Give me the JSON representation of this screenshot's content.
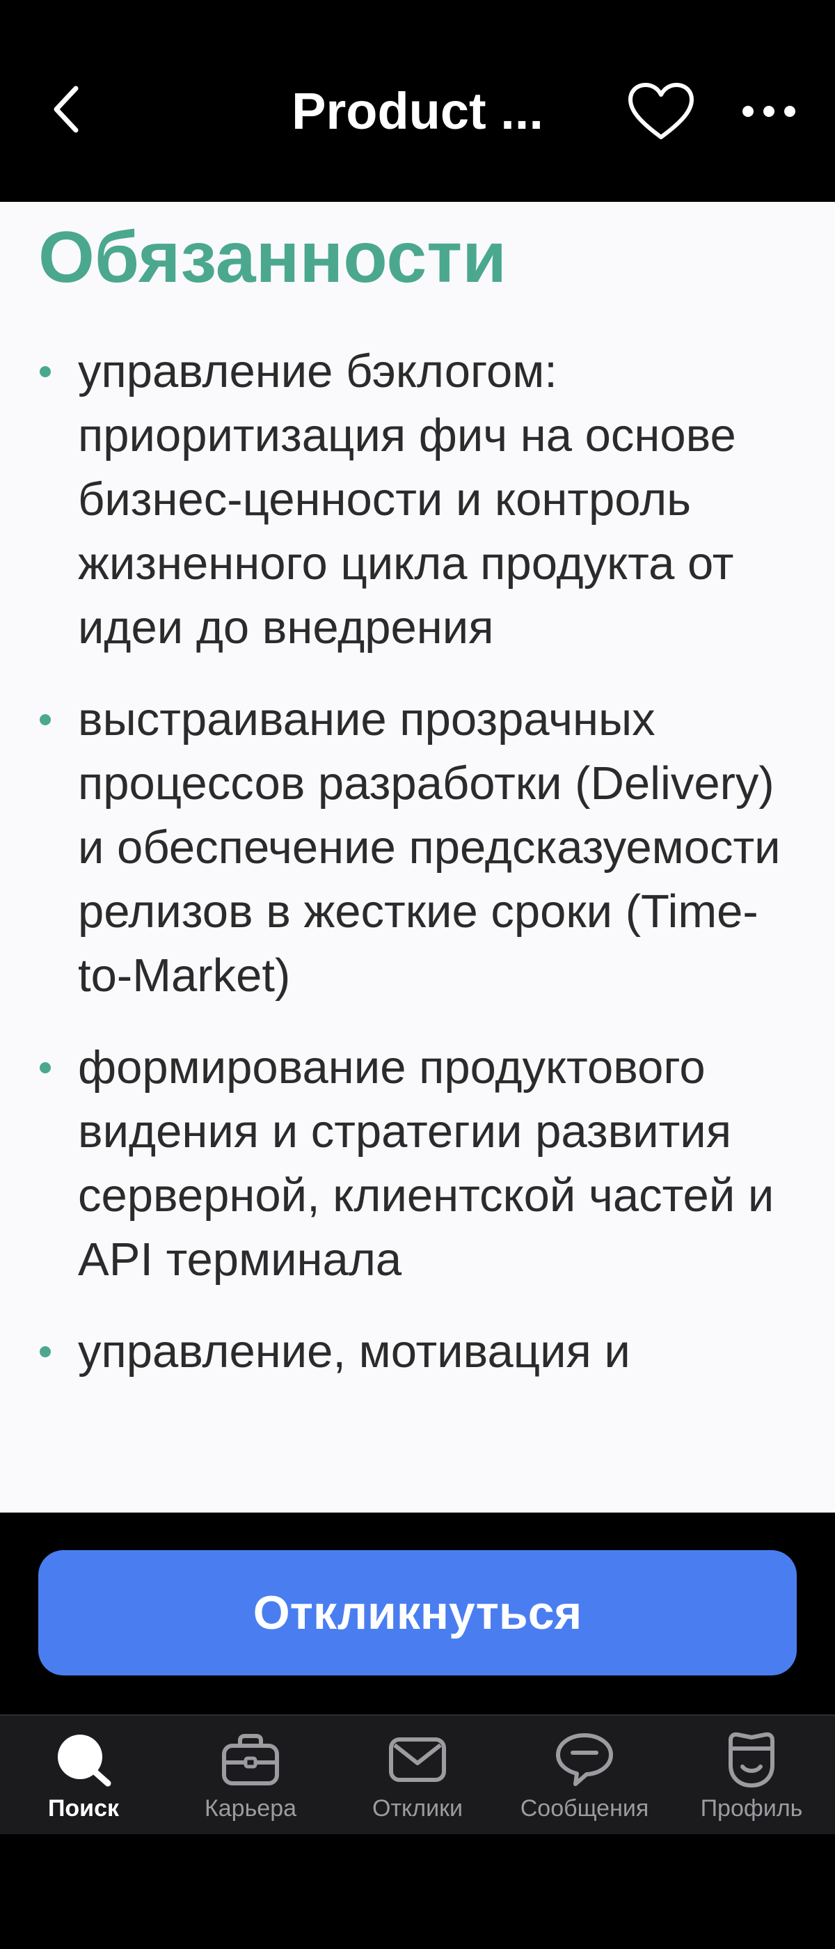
{
  "header": {
    "title": "Product ...",
    "back_icon": "chevron-left-icon",
    "favorite_icon": "heart-outline-icon",
    "more_icon": "more-horizontal-icon"
  },
  "content": {
    "section_title": "Обязанности",
    "duties": [
      "управление бэклогом: приоритизация фич на основе бизнес-ценности и контроль жизненного цикла продукта от идеи до внедрения",
      "выстраивание прозрачных процессов разработки (Delivery) и обеспечение предсказуемости релизов в жесткие сроки (Time-to-Market)",
      "формирование продуктового видения и стратегии развития серверной, клиентской частей и API терминала",
      "управление, мотивация и"
    ]
  },
  "action": {
    "respond_label": "Откликнуться"
  },
  "nav": {
    "items": [
      {
        "label": "Поиск",
        "icon": "search-icon",
        "active": true
      },
      {
        "label": "Карьера",
        "icon": "briefcase-icon",
        "active": false
      },
      {
        "label": "Отклики",
        "icon": "envelope-icon",
        "active": false
      },
      {
        "label": "Сообщения",
        "icon": "chat-bubble-icon",
        "active": false
      },
      {
        "label": "Профиль",
        "icon": "profile-face-icon",
        "active": false
      }
    ]
  },
  "colors": {
    "accent_green": "#4ba88f",
    "button_blue": "#4a7ef0",
    "nav_background": "#1b1b1d",
    "content_background": "#fafafc"
  }
}
